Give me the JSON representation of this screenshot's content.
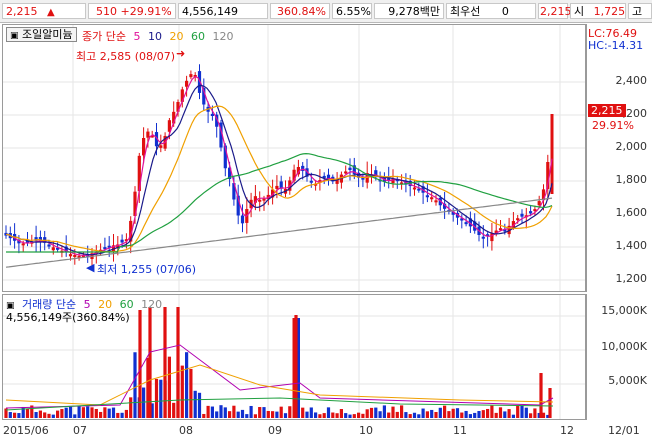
{
  "topbar": {
    "price": "2,215",
    "change": "510",
    "change_pct": "+29.91%",
    "volume": "4,556,149",
    "volume_pct": "360.84%",
    "turnover": "6.55%",
    "amount": "9,278백만",
    "pref_label": "최우선",
    "pref_value": "0",
    "ask_price": "2,215",
    "open_label": "시",
    "open_value": "1,725",
    "high_label": "고"
  },
  "price_panel": {
    "toggle_label": "조일알미늄",
    "ma_title": "종가 단순",
    "ma_periods": [
      "5",
      "10",
      "20",
      "60",
      "120"
    ],
    "ma_colors": [
      "#e0109a",
      "#1a1a8a",
      "#f0a000",
      "#20a040",
      "#888888"
    ],
    "lc_label": "LC:76.49",
    "hc_label": "HC:-14.31",
    "high_marker": "최고 2,585 (08/07)",
    "low_marker": "최저 1,255 (07/06)",
    "current_price": "2,215",
    "current_pct": "29.91%",
    "y_ticks": [
      "2,400",
      "2,200",
      "2,000",
      "1,800",
      "1,600",
      "1,400",
      "1,200"
    ]
  },
  "volume_panel": {
    "ma_title": "거래량 단순",
    "ma_periods": [
      "5",
      "20",
      "60",
      "120"
    ],
    "ma_colors": [
      "#b000b0",
      "#f0a000",
      "#20a040",
      "#888888"
    ],
    "current_volume": "4,556,149주(360.84%)",
    "y_ticks": [
      "15,000K",
      "10,000K",
      "5,000K"
    ]
  },
  "x_axis": {
    "labels": [
      "2015/06",
      "07",
      "08",
      "09",
      "10",
      "11",
      "12",
      "12/01"
    ]
  },
  "colors": {
    "up": "#e01010",
    "down": "#1030d0",
    "accent": "#e01010"
  }
}
